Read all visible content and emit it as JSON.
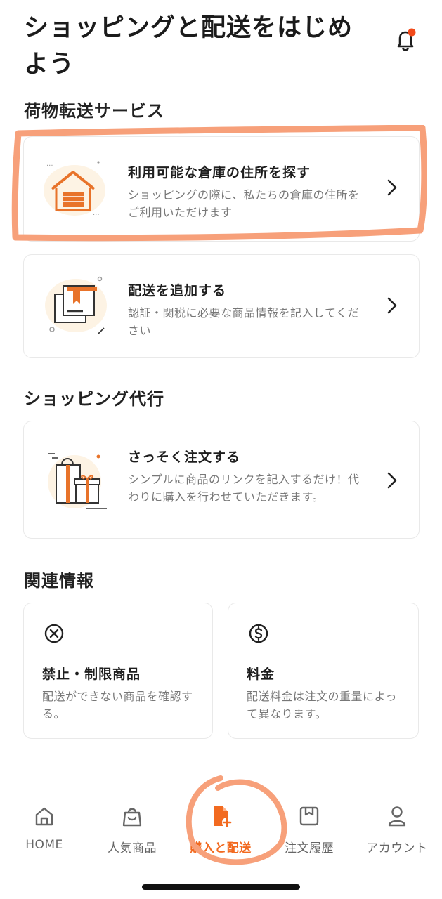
{
  "header": {
    "title": "ショッピングと配送をはじめよう",
    "notification_icon": "bell-icon",
    "has_badge": true
  },
  "sections": {
    "forwarding": {
      "title": "荷物転送サービス",
      "cards": [
        {
          "title": "利用可能な倉庫の住所を探す",
          "desc": "ショッピングの際に、私たちの倉庫の住所をご利用いただけます",
          "icon": "warehouse-icon"
        },
        {
          "title": "配送を追加する",
          "desc": "認証・関税に必要な商品情報を記入してください",
          "icon": "package-icon"
        }
      ]
    },
    "proxy": {
      "title": "ショッピング代行",
      "cards": [
        {
          "title": "さっそく注文する",
          "desc": "シンプルに商品のリンクを記入するだけ！代わりに購入を行わせていただきます。",
          "icon": "gift-bag-icon"
        }
      ]
    },
    "info": {
      "title": "関連情報",
      "cards": [
        {
          "title": "禁止・制限商品",
          "desc": "配送ができない商品を確認する。",
          "icon": "prohibited-icon"
        },
        {
          "title": "料金",
          "desc": "配送料金は注文の重量によって異なります。",
          "icon": "dollar-icon"
        }
      ]
    }
  },
  "bottom_nav": {
    "items": [
      {
        "label": "HOME",
        "icon": "home-icon"
      },
      {
        "label": "人気商品",
        "icon": "shopping-bag-icon"
      },
      {
        "label": "購入と配送",
        "icon": "document-add-icon",
        "active": true
      },
      {
        "label": "注文履歴",
        "icon": "order-history-icon"
      },
      {
        "label": "アカウント",
        "icon": "account-icon"
      }
    ]
  },
  "colors": {
    "accent": "#f26a20",
    "highlight": "#f7a07a",
    "card_border": "#e9e9e9",
    "text_secondary": "#777777"
  }
}
